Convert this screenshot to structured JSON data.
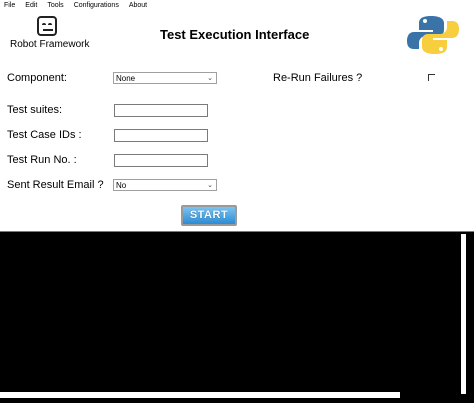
{
  "menu": [
    "File",
    "Edit",
    "Tools",
    "Configurations",
    "About"
  ],
  "header": {
    "logo_text": "Robot Framework",
    "title": "Test Execution Interface"
  },
  "form": {
    "component_label": "Component:",
    "component_value": "None",
    "rerun_label": "Re-Run Failures ?",
    "test_suites_label": "Test suites:",
    "test_suites_value": "",
    "test_case_ids_label": "Test Case IDs :",
    "test_case_ids_value": "",
    "test_run_label": "Test Run No. :",
    "test_run_value": "",
    "email_label": "Sent Result Email ?",
    "email_value": "No"
  },
  "start_label": "START",
  "colors": {
    "start_top": "#7cc4f0",
    "start_bottom": "#2b8bd4",
    "python_blue": "#3a73a8",
    "python_yellow": "#f7cf3e",
    "console_bg": "#000000"
  }
}
